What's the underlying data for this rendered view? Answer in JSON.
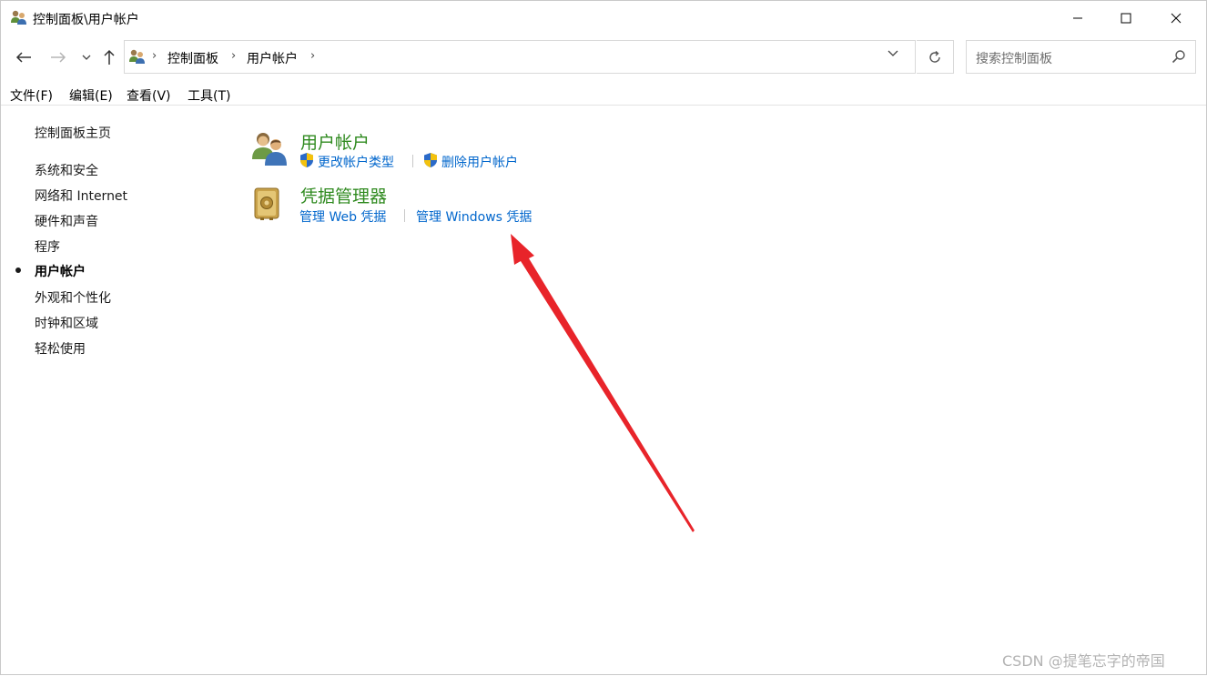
{
  "window": {
    "title": "控制面板\\用户帐户",
    "icon": "user-accounts-icon"
  },
  "nav": {
    "back": "back-arrow-icon",
    "forward": "forward-arrow-icon",
    "recent": "chevron-down-icon",
    "up": "up-arrow-icon"
  },
  "address": {
    "crumbs": [
      "控制面板",
      "用户帐户"
    ]
  },
  "search": {
    "placeholder": "搜索控制面板"
  },
  "menu": {
    "items": [
      "文件(F)",
      "编辑(E)",
      "查看(V)",
      "工具(T)"
    ]
  },
  "sidebar": {
    "home": "控制面板主页",
    "items": [
      "系统和安全",
      "网络和 Internet",
      "硬件和声音",
      "程序",
      "用户帐户",
      "外观和个性化",
      "时钟和区域",
      "轻松使用"
    ],
    "current": "用户帐户"
  },
  "categories": [
    {
      "title": "用户帐户",
      "icon": "user-accounts-icon",
      "tasks": [
        {
          "label": "更改帐户类型",
          "icon": "uac-shield-icon"
        },
        {
          "label": "删除用户帐户",
          "icon": "uac-shield-icon"
        }
      ]
    },
    {
      "title": "凭据管理器",
      "icon": "credential-vault-icon",
      "tasks": [
        {
          "label": "管理 Web 凭据"
        },
        {
          "label": "管理 Windows 凭据"
        }
      ]
    }
  ],
  "annotation": {
    "arrow_color": "#e8242a"
  },
  "watermark": "CSDN @提笔忘字的帝国",
  "colors": {
    "link": "#0066cc",
    "category_title": "#2f8a1f"
  }
}
